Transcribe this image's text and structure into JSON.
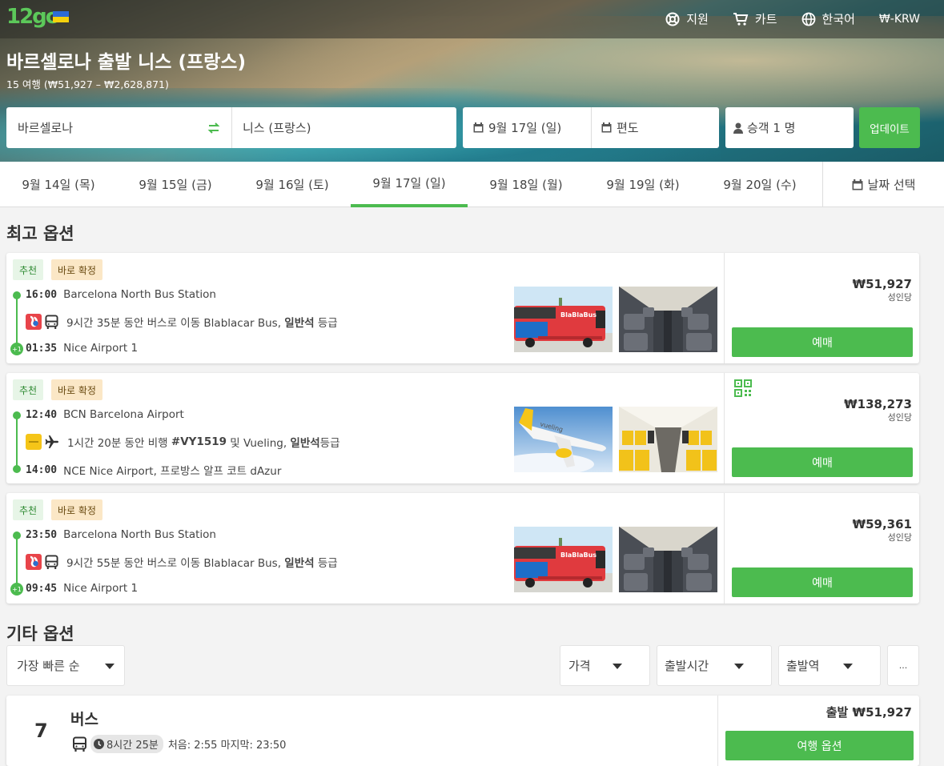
{
  "header": {
    "logo": "12go",
    "support": "지원",
    "cart": "카트",
    "language": "한국어",
    "currency": "₩-KRW"
  },
  "title": "바르셀로나 출발 니스 (프랑스)",
  "subtitle": "15 여행 (₩51,927 – ₩2,628,871)",
  "search": {
    "from": "바르셀로나",
    "to": "니스 (프랑스)",
    "date": "9월 17일 (일)",
    "trip": "편도",
    "passengers": "승객 1 명",
    "update": "업데이트"
  },
  "dates": [
    {
      "label": "9월 14일 (목)",
      "active": false
    },
    {
      "label": "9월 15일 (금)",
      "active": false
    },
    {
      "label": "9월 16일 (토)",
      "active": false
    },
    {
      "label": "9월 17일 (일)",
      "active": true
    },
    {
      "label": "9월 18일 (월)",
      "active": false
    },
    {
      "label": "9월 19일 (화)",
      "active": false
    },
    {
      "label": "9월 20일 (수)",
      "active": false
    }
  ],
  "date_picker": "날짜 선택",
  "best_title": "최고 옵션",
  "options": [
    {
      "badge_recommended": "추천",
      "badge_confirm": "바로 확정",
      "dep_time": "16:00",
      "dep_station": "Barcelona North Bus Station",
      "duration": "9시간 35분 동안 버스로 이동 Blablacar Bus,",
      "class_bold": "일반석",
      "class_suffix": " 등급",
      "arr_time": "01:35",
      "arr_station": "Nice Airport 1",
      "plus_day": "+1",
      "price": "₩51,927",
      "per": "성인당",
      "book": "예매",
      "type": "bus"
    },
    {
      "badge_recommended": "추천",
      "badge_confirm": "바로 확정",
      "dep_time": "12:40",
      "dep_station": "BCN Barcelona Airport",
      "duration": "1시간 20분 동안 비행",
      "flight_no": "#VY1519",
      "flight_suffix": "및 Vueling,",
      "class_bold": "일반석",
      "class_suffix": "등급",
      "arr_time": "14:00",
      "arr_station": "NCE Nice Airport, 프로방스 알프 코트 dAzur",
      "plus_day": "",
      "price": "₩138,273",
      "per": "성인당",
      "book": "예매",
      "type": "flight"
    },
    {
      "badge_recommended": "추천",
      "badge_confirm": "바로 확정",
      "dep_time": "23:50",
      "dep_station": "Barcelona North Bus Station",
      "duration": "9시간 55분 동안 버스로 이동 Blablacar Bus,",
      "class_bold": "일반석",
      "class_suffix": " 등급",
      "arr_time": "09:45",
      "arr_station": "Nice Airport 1",
      "plus_day": "+1",
      "price": "₩59,361",
      "per": "성인당",
      "book": "예매",
      "type": "bus"
    }
  ],
  "other_title": "기타 옵션",
  "filters": {
    "sort": "가장 빠른 순",
    "price": "가격",
    "departure_time": "출발시간",
    "departure_station": "출발역",
    "more": "..."
  },
  "group": {
    "count": "7",
    "mode": "버스",
    "duration": "8시간 25분",
    "first_last": "처음: 2:55 마지막: 23:50",
    "price": "출발 ₩51,927",
    "button": "여행 옵션"
  },
  "colors": {
    "accent": "#4cbb4f",
    "blablacar": "#e8444a",
    "vueling": "#f5c518"
  }
}
